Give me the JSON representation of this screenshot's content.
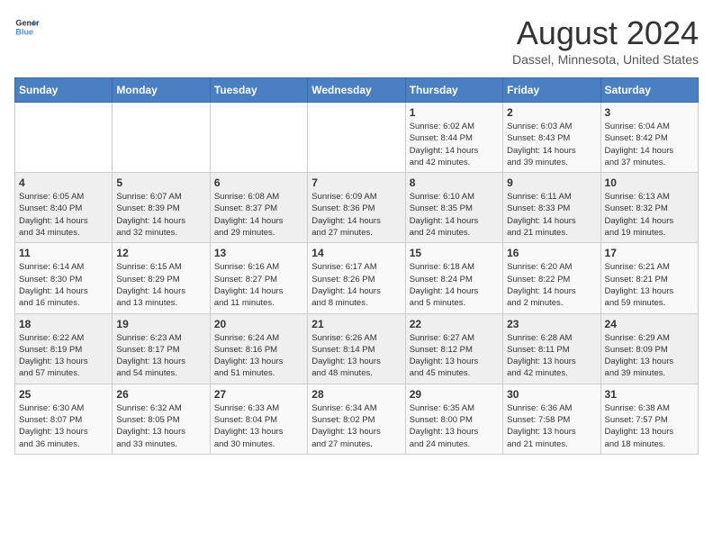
{
  "header": {
    "logo_line1": "General",
    "logo_line2": "Blue",
    "month_year": "August 2024",
    "location": "Dassel, Minnesota, United States"
  },
  "weekdays": [
    "Sunday",
    "Monday",
    "Tuesday",
    "Wednesday",
    "Thursday",
    "Friday",
    "Saturday"
  ],
  "weeks": [
    [
      {
        "day": "",
        "info": ""
      },
      {
        "day": "",
        "info": ""
      },
      {
        "day": "",
        "info": ""
      },
      {
        "day": "",
        "info": ""
      },
      {
        "day": "1",
        "info": "Sunrise: 6:02 AM\nSunset: 8:44 PM\nDaylight: 14 hours\nand 42 minutes."
      },
      {
        "day": "2",
        "info": "Sunrise: 6:03 AM\nSunset: 8:43 PM\nDaylight: 14 hours\nand 39 minutes."
      },
      {
        "day": "3",
        "info": "Sunrise: 6:04 AM\nSunset: 8:42 PM\nDaylight: 14 hours\nand 37 minutes."
      }
    ],
    [
      {
        "day": "4",
        "info": "Sunrise: 6:05 AM\nSunset: 8:40 PM\nDaylight: 14 hours\nand 34 minutes."
      },
      {
        "day": "5",
        "info": "Sunrise: 6:07 AM\nSunset: 8:39 PM\nDaylight: 14 hours\nand 32 minutes."
      },
      {
        "day": "6",
        "info": "Sunrise: 6:08 AM\nSunset: 8:37 PM\nDaylight: 14 hours\nand 29 minutes."
      },
      {
        "day": "7",
        "info": "Sunrise: 6:09 AM\nSunset: 8:36 PM\nDaylight: 14 hours\nand 27 minutes."
      },
      {
        "day": "8",
        "info": "Sunrise: 6:10 AM\nSunset: 8:35 PM\nDaylight: 14 hours\nand 24 minutes."
      },
      {
        "day": "9",
        "info": "Sunrise: 6:11 AM\nSunset: 8:33 PM\nDaylight: 14 hours\nand 21 minutes."
      },
      {
        "day": "10",
        "info": "Sunrise: 6:13 AM\nSunset: 8:32 PM\nDaylight: 14 hours\nand 19 minutes."
      }
    ],
    [
      {
        "day": "11",
        "info": "Sunrise: 6:14 AM\nSunset: 8:30 PM\nDaylight: 14 hours\nand 16 minutes."
      },
      {
        "day": "12",
        "info": "Sunrise: 6:15 AM\nSunset: 8:29 PM\nDaylight: 14 hours\nand 13 minutes."
      },
      {
        "day": "13",
        "info": "Sunrise: 6:16 AM\nSunset: 8:27 PM\nDaylight: 14 hours\nand 11 minutes."
      },
      {
        "day": "14",
        "info": "Sunrise: 6:17 AM\nSunset: 8:26 PM\nDaylight: 14 hours\nand 8 minutes."
      },
      {
        "day": "15",
        "info": "Sunrise: 6:18 AM\nSunset: 8:24 PM\nDaylight: 14 hours\nand 5 minutes."
      },
      {
        "day": "16",
        "info": "Sunrise: 6:20 AM\nSunset: 8:22 PM\nDaylight: 14 hours\nand 2 minutes."
      },
      {
        "day": "17",
        "info": "Sunrise: 6:21 AM\nSunset: 8:21 PM\nDaylight: 13 hours\nand 59 minutes."
      }
    ],
    [
      {
        "day": "18",
        "info": "Sunrise: 6:22 AM\nSunset: 8:19 PM\nDaylight: 13 hours\nand 57 minutes."
      },
      {
        "day": "19",
        "info": "Sunrise: 6:23 AM\nSunset: 8:17 PM\nDaylight: 13 hours\nand 54 minutes."
      },
      {
        "day": "20",
        "info": "Sunrise: 6:24 AM\nSunset: 8:16 PM\nDaylight: 13 hours\nand 51 minutes."
      },
      {
        "day": "21",
        "info": "Sunrise: 6:26 AM\nSunset: 8:14 PM\nDaylight: 13 hours\nand 48 minutes."
      },
      {
        "day": "22",
        "info": "Sunrise: 6:27 AM\nSunset: 8:12 PM\nDaylight: 13 hours\nand 45 minutes."
      },
      {
        "day": "23",
        "info": "Sunrise: 6:28 AM\nSunset: 8:11 PM\nDaylight: 13 hours\nand 42 minutes."
      },
      {
        "day": "24",
        "info": "Sunrise: 6:29 AM\nSunset: 8:09 PM\nDaylight: 13 hours\nand 39 minutes."
      }
    ],
    [
      {
        "day": "25",
        "info": "Sunrise: 6:30 AM\nSunset: 8:07 PM\nDaylight: 13 hours\nand 36 minutes."
      },
      {
        "day": "26",
        "info": "Sunrise: 6:32 AM\nSunset: 8:05 PM\nDaylight: 13 hours\nand 33 minutes."
      },
      {
        "day": "27",
        "info": "Sunrise: 6:33 AM\nSunset: 8:04 PM\nDaylight: 13 hours\nand 30 minutes."
      },
      {
        "day": "28",
        "info": "Sunrise: 6:34 AM\nSunset: 8:02 PM\nDaylight: 13 hours\nand 27 minutes."
      },
      {
        "day": "29",
        "info": "Sunrise: 6:35 AM\nSunset: 8:00 PM\nDaylight: 13 hours\nand 24 minutes."
      },
      {
        "day": "30",
        "info": "Sunrise: 6:36 AM\nSunset: 7:58 PM\nDaylight: 13 hours\nand 21 minutes."
      },
      {
        "day": "31",
        "info": "Sunrise: 6:38 AM\nSunset: 7:57 PM\nDaylight: 13 hours\nand 18 minutes."
      }
    ]
  ]
}
